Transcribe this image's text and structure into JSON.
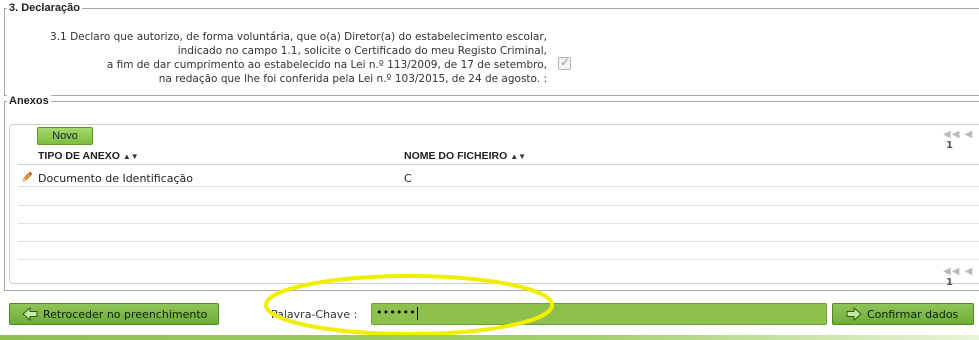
{
  "declaracao": {
    "title": "3. Declaração",
    "lines": [
      "3.1 Declaro que autorizo, de forma voluntária, que o(a) Diretor(a) do estabelecimento escolar,",
      "indicado no campo 1.1, solicite o Certificado do meu Registo Criminal,",
      "a fim de dar cumprimento ao estabelecido na Lei n.º 113/2009, de 17 de setembro,",
      "na redação que lhe foi conferida pela Lei n.º 103/2015, de 24 de agosto. :"
    ],
    "checked": true
  },
  "anexos": {
    "title": "Anexos",
    "novo_label": "Novo",
    "pager_page": "1",
    "columns": [
      "TIPO DE ANEXO",
      "NOME DO FICHEIRO"
    ],
    "rows": [
      {
        "tipo": "Documento de Identificação",
        "nome": "C"
      }
    ]
  },
  "footer": {
    "back_label": "Retroceder no preenchimento",
    "keyword_label": "Palavra-Chave :",
    "keyword_value": "••••••",
    "confirm_label": "Confirmar dados"
  },
  "colors": {
    "accent_green": "#7cbf3a",
    "highlight_yellow": "#f5f000"
  },
  "icons": [
    "checkbox-icon",
    "sort-icon",
    "pager-first-icon",
    "pager-prev-icon",
    "edit-pencil-icon",
    "arrow-left-icon",
    "arrow-right-icon"
  ]
}
